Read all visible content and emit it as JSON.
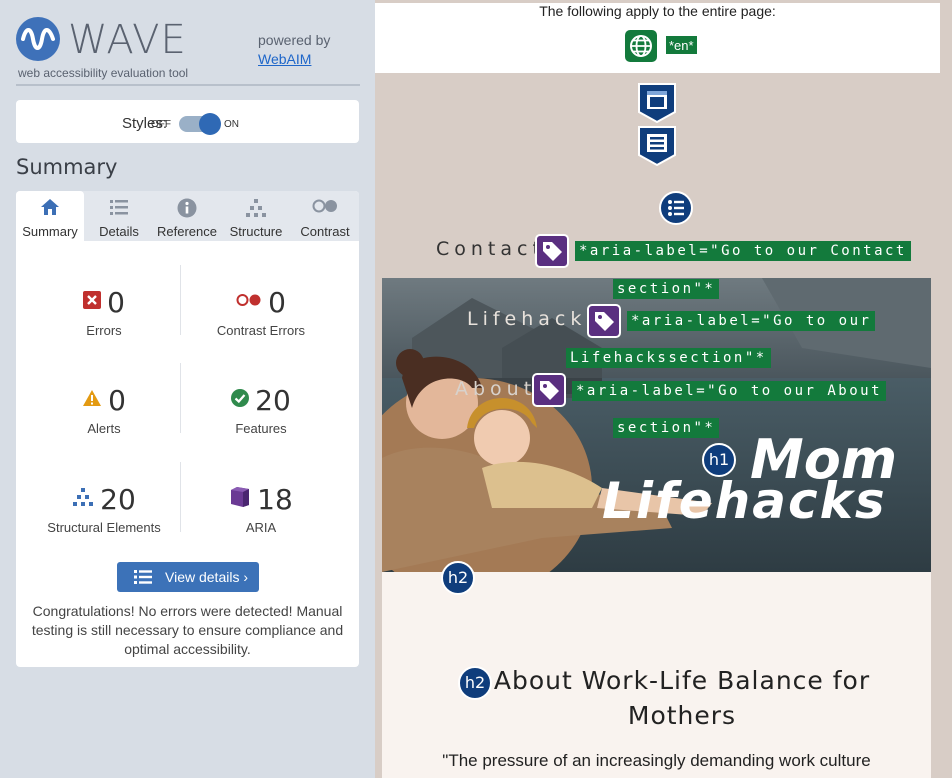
{
  "app": {
    "logo_word": "WAVE",
    "tagline": "web accessibility evaluation tool",
    "powered_by": "powered by",
    "webaim_link": "WebAIM"
  },
  "styles_toggle": {
    "label": "Styles:",
    "off": "OFF",
    "on": "ON",
    "state": "on"
  },
  "summary": {
    "heading": "Summary",
    "tabs": [
      {
        "label": "Summary",
        "icon": "home-icon",
        "active": true
      },
      {
        "label": "Details",
        "icon": "list-icon"
      },
      {
        "label": "Reference",
        "icon": "info-icon"
      },
      {
        "label": "Structure",
        "icon": "structure-icon"
      },
      {
        "label": "Contrast",
        "icon": "contrast-icon"
      }
    ],
    "stats": {
      "errors": {
        "value": "0",
        "label": "Errors"
      },
      "contrast_errors": {
        "value": "0",
        "label": "Contrast Errors"
      },
      "alerts": {
        "value": "0",
        "label": "Alerts"
      },
      "features": {
        "value": "20",
        "label": "Features"
      },
      "structural": {
        "value": "20",
        "label": "Structural Elements"
      },
      "aria": {
        "value": "18",
        "label": "ARIA"
      }
    },
    "view_details": "View details ›",
    "congrats": "Congratulations! No errors were detected! Manual testing is still necessary to ensure compliance and optimal accessibility."
  },
  "page": {
    "top_text": "The following apply to the entire page:",
    "lang_flag": "*en*",
    "nav": [
      {
        "text": "Contact",
        "aria_line1": "*aria-label=\"Go to our Contact",
        "aria_line2": "section\"*"
      },
      {
        "text": "Lifehacks",
        "aria_line1": "*aria-label=\"Go to our",
        "aria_line2": "Lifehackssection\"*"
      },
      {
        "text": "About",
        "aria_line1": "*aria-label=\"Go to our About",
        "aria_line2": "section\"*"
      }
    ],
    "hero": {
      "line1": "Mom",
      "line2": "Lifehacks",
      "h1_badge": "h1"
    },
    "h2_badge": "h2",
    "section_title": "About Work-Life Balance for Mothers",
    "quote": "\"The pressure of an increasingly demanding work culture"
  },
  "colors": {
    "wave_blue": "#3c72b8",
    "error_red": "#c0302e",
    "alert_orange": "#e39a12",
    "feature_green": "#2f8a4c",
    "aria_purple": "#5a2f80",
    "structure_navy": "#0f3d7c",
    "flag_green": "#137a3c"
  }
}
